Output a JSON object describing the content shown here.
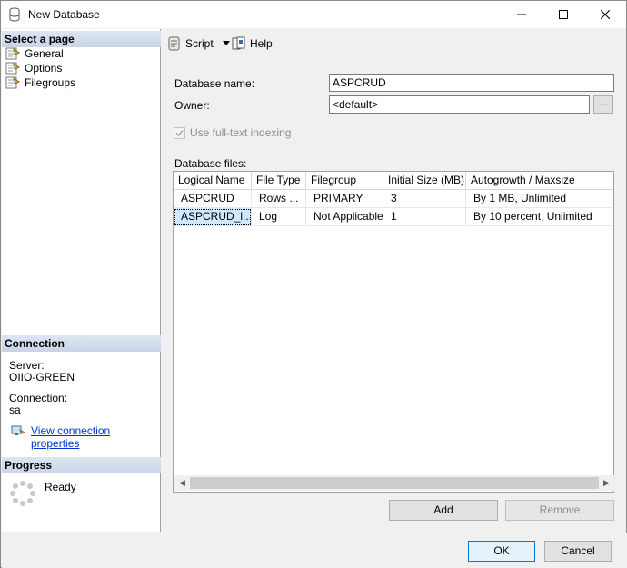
{
  "window": {
    "title": "New Database"
  },
  "left": {
    "select_page_header": "Select a page",
    "pages": [
      {
        "label": "General",
        "icon": "page-icon"
      },
      {
        "label": "Options",
        "icon": "page-icon"
      },
      {
        "label": "Filegroups",
        "icon": "page-icon"
      }
    ],
    "connection_header": "Connection",
    "server_label": "Server:",
    "server_value": "OIIO-GREEN",
    "connection_label": "Connection:",
    "connection_value": "sa",
    "view_props_link": "View connection properties",
    "progress_header": "Progress",
    "progress_status": "Ready"
  },
  "toolbar": {
    "script_label": "Script",
    "help_label": "Help"
  },
  "form": {
    "db_name_label": "Database name:",
    "db_name_value": "ASPCRUD",
    "owner_label": "Owner:",
    "owner_value": "<default>",
    "owner_browse_label": "...",
    "fulltext_label": "Use full-text indexing",
    "files_label": "Database files:"
  },
  "grid": {
    "columns": [
      "Logical Name",
      "File Type",
      "Filegroup",
      "Initial Size (MB)",
      "Autogrowth / Maxsize"
    ],
    "rows": [
      [
        "ASPCRUD",
        "Rows ...",
        "PRIMARY",
        "3",
        "By 1 MB, Unlimited"
      ],
      [
        "ASPCRUD_l...",
        "Log",
        "Not Applicable",
        "1",
        "By 10 percent, Unlimited"
      ]
    ]
  },
  "buttons": {
    "add": "Add",
    "remove": "Remove",
    "ok": "OK",
    "cancel": "Cancel"
  }
}
